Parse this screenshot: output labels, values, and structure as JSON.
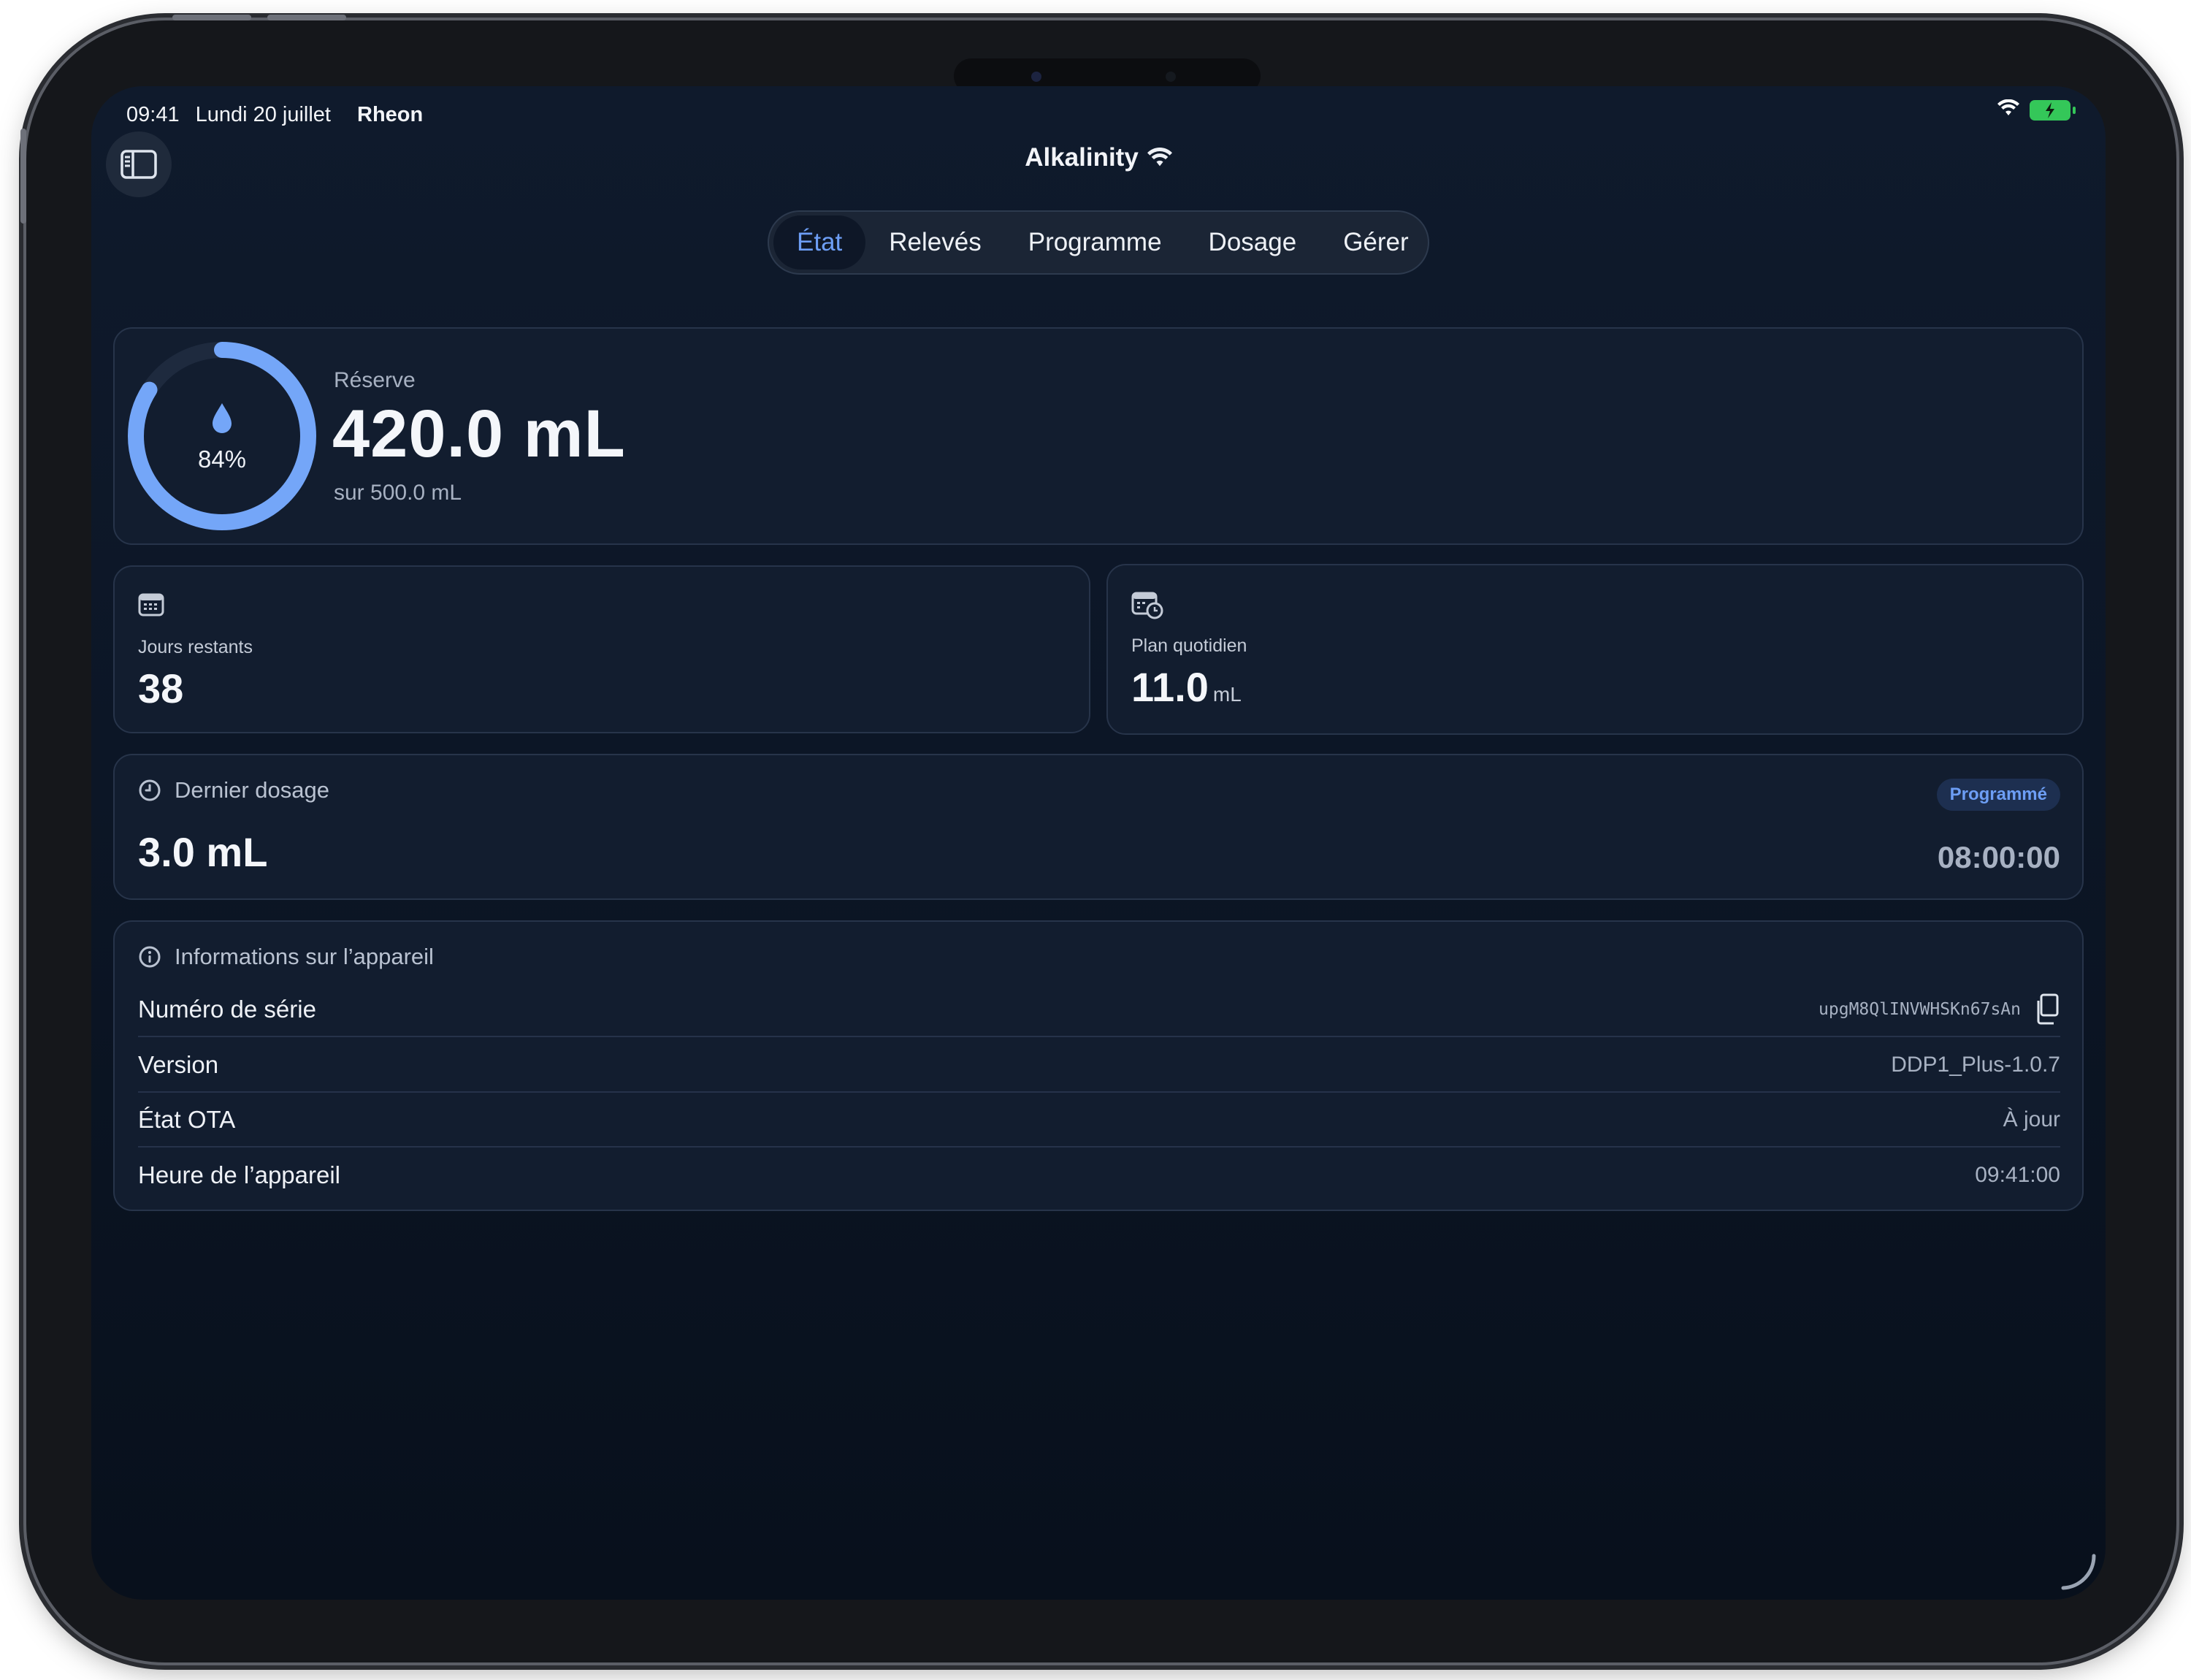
{
  "status_bar": {
    "time": "09:41",
    "date": "Lundi 20 juillet",
    "carrier": "Rheon"
  },
  "header": {
    "title": "Alkalinity"
  },
  "tabs": [
    {
      "label": "État",
      "active": true
    },
    {
      "label": "Relevés",
      "active": false
    },
    {
      "label": "Programme",
      "active": false
    },
    {
      "label": "Dosage",
      "active": false
    },
    {
      "label": "Gérer",
      "active": false
    }
  ],
  "reserve": {
    "label": "Réserve",
    "value": "420.0 mL",
    "capacity": "sur 500.0 mL",
    "percent_text": "84%",
    "fill_fraction": 0.84
  },
  "days_remaining": {
    "label": "Jours restants",
    "value": "38"
  },
  "daily_plan": {
    "label": "Plan quotidien",
    "value": "11.0",
    "unit": "mL"
  },
  "last_dose": {
    "label": "Dernier dosage",
    "amount": "3.0 mL",
    "badge": "Programmé",
    "time": "08:00:00"
  },
  "device_info": {
    "title": "Informations sur l’appareil",
    "rows": [
      {
        "key": "Numéro de série",
        "value": "upgM8QlINVWHSKn67sAn"
      },
      {
        "key": "Version",
        "value": "DDP1_Plus-1.0.7"
      },
      {
        "key": "État OTA",
        "value": "À jour"
      },
      {
        "key": "Heure de l’appareil",
        "value": "09:41:00"
      }
    ]
  },
  "colors": {
    "accent": "#6d9ef5",
    "background": "#0c1626",
    "card": "#121d2f",
    "battery": "#34c759"
  }
}
